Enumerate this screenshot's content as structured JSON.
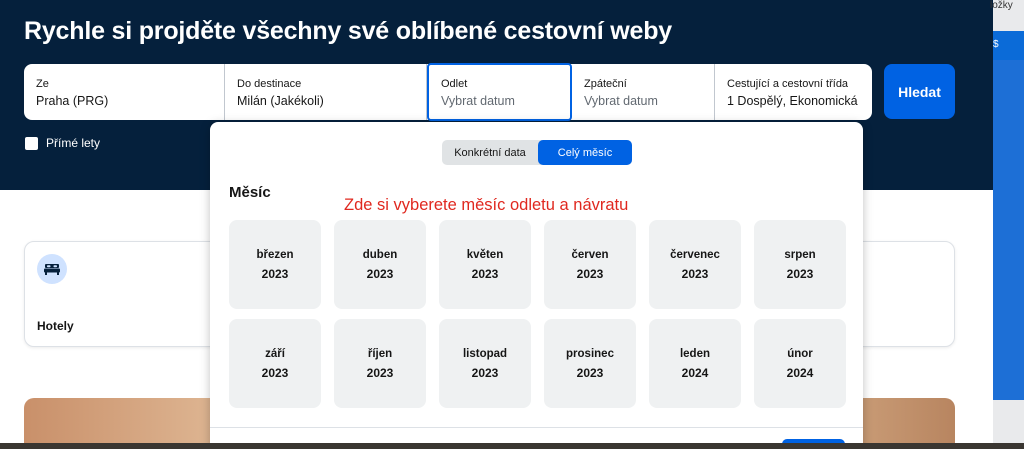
{
  "header": {
    "title": "Rychle si projděte všechny své oblíbené cestovní weby"
  },
  "search": {
    "from": {
      "label": "Ze",
      "value": "Praha (PRG)"
    },
    "to": {
      "label": "Do destinace",
      "value": "Milán (Jakékoli)"
    },
    "depart": {
      "label": "Odlet",
      "placeholder": "Vybrat datum"
    },
    "return": {
      "label": "Zpáteční",
      "placeholder": "Vybrat datum"
    },
    "passengers": {
      "label": "Cestující a cestovní třída",
      "value": "1 Dospělý, Ekonomická ..."
    },
    "button": "Hledat"
  },
  "direct_flights": {
    "label": "Přímé lety",
    "checked": false
  },
  "popover": {
    "toggle": {
      "specific": "Konkrétní data",
      "whole_month": "Celý měsíc",
      "selected": "whole_month"
    },
    "heading": "Měsíc",
    "annotation": "Zde si vyberete měsíc  odletu a návratu",
    "months": [
      {
        "name": "březen",
        "year": "2023"
      },
      {
        "name": "duben",
        "year": "2023"
      },
      {
        "name": "květen",
        "year": "2023"
      },
      {
        "name": "červen",
        "year": "2023"
      },
      {
        "name": "červenec",
        "year": "2023"
      },
      {
        "name": "srpen",
        "year": "2023"
      },
      {
        "name": "září",
        "year": "2023"
      },
      {
        "name": "říjen",
        "year": "2023"
      },
      {
        "name": "listopad",
        "year": "2023"
      },
      {
        "name": "prosinec",
        "year": "2023"
      },
      {
        "name": "leden",
        "year": "2024"
      },
      {
        "name": "únor",
        "year": "2024"
      }
    ]
  },
  "card": {
    "icon": "bed-icon",
    "label": "Hotely"
  },
  "side_panel": {
    "top_text": "ložky",
    "dollar": "$"
  },
  "colors": {
    "navy": "#05203c",
    "accent": "#0062e3",
    "annotation": "#e0281f"
  }
}
